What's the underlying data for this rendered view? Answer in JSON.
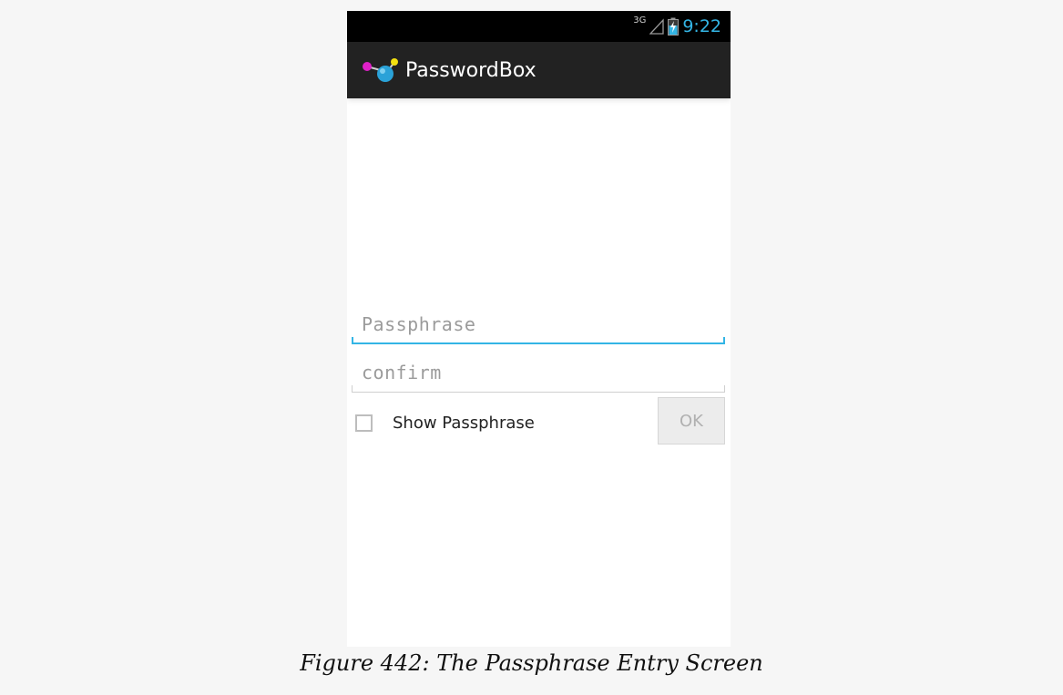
{
  "status_bar": {
    "network_type": "3G",
    "time": "9:22",
    "icons": [
      "signal-icon",
      "battery-charging-icon"
    ]
  },
  "action_bar": {
    "app_icon": "app-logo-icon",
    "title": "PasswordBox"
  },
  "form": {
    "passphrase": {
      "value": "",
      "placeholder": "Passphrase",
      "focused": true
    },
    "confirm": {
      "value": "",
      "placeholder": "confirm",
      "focused": false
    },
    "show_passphrase": {
      "label": "Show Passphrase",
      "checked": false
    },
    "ok_button": {
      "label": "OK",
      "enabled": false
    }
  },
  "colors": {
    "accent": "#33b5e5",
    "action_bar": "#222222",
    "status_bar": "#000000"
  },
  "caption": "Figure 442: The Passphrase Entry Screen"
}
